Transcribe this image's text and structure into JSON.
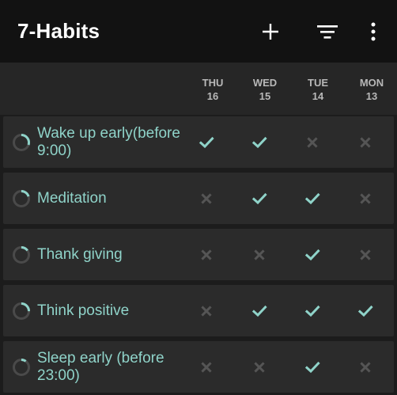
{
  "app": {
    "title": "7-Habits"
  },
  "toolbar": {
    "add_icon": "plus-icon",
    "filter_icon": "filter-icon",
    "menu_icon": "more-vert-icon"
  },
  "colors": {
    "accent": "#8fd3c9",
    "unchecked": "#555555",
    "row_bg": "#2b2b2b",
    "appbar_bg": "#121212"
  },
  "days": [
    {
      "name": "THU",
      "date": "16"
    },
    {
      "name": "WED",
      "date": "15"
    },
    {
      "name": "TUE",
      "date": "14"
    },
    {
      "name": "MON",
      "date": "13"
    }
  ],
  "habits": [
    {
      "name": "Wake up early(before 9:00)",
      "score": 0.3,
      "checks": [
        true,
        true,
        false,
        false
      ]
    },
    {
      "name": "Meditation",
      "score": 0.2,
      "checks": [
        false,
        true,
        true,
        false
      ]
    },
    {
      "name": "Thank giving",
      "score": 0.15,
      "checks": [
        false,
        false,
        true,
        false
      ]
    },
    {
      "name": "Think positive",
      "score": 0.25,
      "checks": [
        false,
        true,
        true,
        true
      ]
    },
    {
      "name": "Sleep early (before 23:00)",
      "score": 0.1,
      "checks": [
        false,
        false,
        true,
        false
      ]
    }
  ]
}
